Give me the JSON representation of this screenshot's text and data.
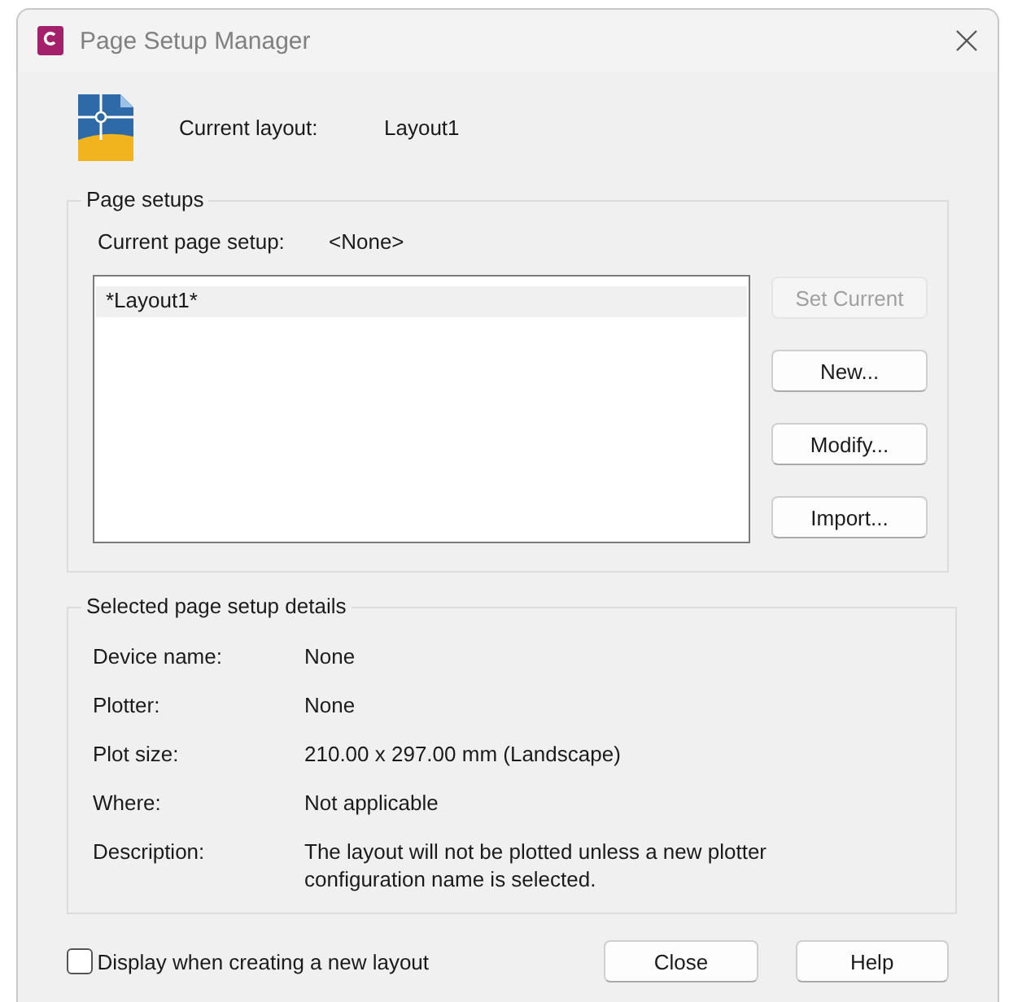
{
  "window": {
    "title": "Page Setup Manager"
  },
  "current_layout": {
    "label": "Current layout:",
    "value": "Layout1"
  },
  "page_setups": {
    "title": "Page setups",
    "current_label": "Current page setup:",
    "current_value": "<None>",
    "items": [
      {
        "label": "*Layout1*",
        "selected": true
      }
    ],
    "buttons": [
      {
        "label": "Set Current",
        "disabled": true
      },
      {
        "label": "New...",
        "disabled": false
      },
      {
        "label": "Modify...",
        "disabled": false
      },
      {
        "label": "Import...",
        "disabled": false
      }
    ]
  },
  "details": {
    "title": "Selected page setup details",
    "rows": [
      {
        "label": "Device name:",
        "value": "None"
      },
      {
        "label": "Plotter:",
        "value": "None"
      },
      {
        "label": "Plot size:",
        "value": "210.00 x 297.00 mm (Landscape)"
      },
      {
        "label": "Where:",
        "value": "Not applicable"
      },
      {
        "label": "Description:",
        "value": "The layout will not be plotted unless a new plotter configuration name is selected."
      }
    ]
  },
  "display_on_create": {
    "label": "Display when creating a new layout",
    "checked": false
  },
  "footer_buttons": [
    "Close",
    "Help"
  ]
}
